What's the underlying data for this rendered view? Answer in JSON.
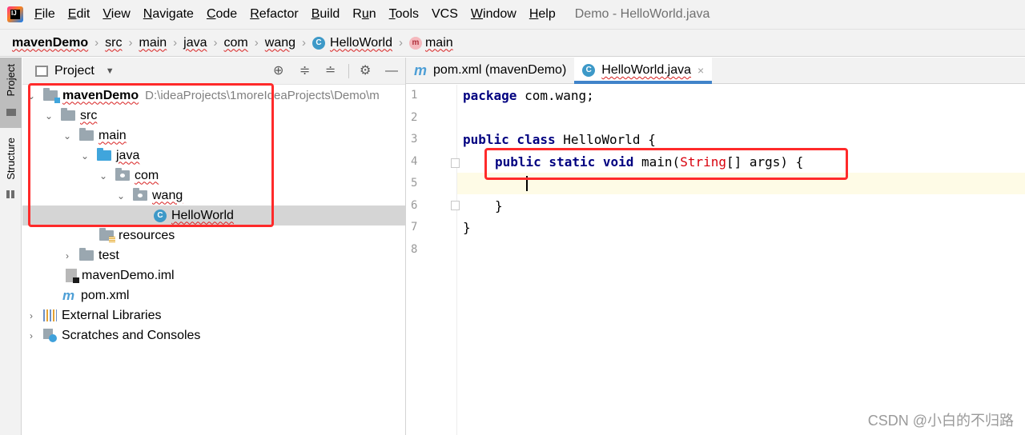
{
  "menubar": {
    "logo_text": "IJ",
    "items": [
      {
        "label": "File",
        "mnemonic": "F",
        "rest": "ile"
      },
      {
        "label": "Edit",
        "mnemonic": "E",
        "rest": "dit"
      },
      {
        "label": "View",
        "mnemonic": "V",
        "rest": "iew"
      },
      {
        "label": "Navigate",
        "mnemonic": "N",
        "rest": "avigate"
      },
      {
        "label": "Code",
        "mnemonic": "C",
        "rest": "ode"
      },
      {
        "label": "Refactor",
        "mnemonic": "R",
        "rest": "efactor"
      },
      {
        "label": "Build",
        "mnemonic": "B",
        "rest": "uild"
      },
      {
        "label": "Run",
        "mnemonic": "u",
        "pre": "R",
        "rest": "n"
      },
      {
        "label": "Tools",
        "mnemonic": "T",
        "rest": "ools"
      },
      {
        "label": "VCS",
        "mnemonic": "",
        "rest": "VCS"
      },
      {
        "label": "Window",
        "mnemonic": "W",
        "rest": "indow"
      },
      {
        "label": "Help",
        "mnemonic": "H",
        "rest": "elp"
      }
    ],
    "window_title": "Demo - HelloWorld.java"
  },
  "breadcrumb": {
    "items": [
      "mavenDemo",
      "src",
      "main",
      "java",
      "com",
      "wang",
      "HelloWorld",
      "main"
    ],
    "class_icon": "C",
    "method_icon": "m"
  },
  "stripe": {
    "project_label": "Project",
    "structure_label": "Structure"
  },
  "project_panel": {
    "title": "Project",
    "tools": [
      "locate-icon",
      "expand-all-icon",
      "collapse-all-icon",
      "gear-icon",
      "minimize-icon"
    ],
    "tree": [
      {
        "name": "mavenDemo",
        "path": "D:\\ideaProjects\\1moreIdeaProjects\\Demo\\m"
      },
      {
        "name": "src"
      },
      {
        "name": "main"
      },
      {
        "name": "java"
      },
      {
        "name": "com"
      },
      {
        "name": "wang"
      },
      {
        "name": "HelloWorld",
        "icon": "C",
        "selected": true
      },
      {
        "name": "resources"
      },
      {
        "name": "test"
      },
      {
        "name": "mavenDemo.iml"
      },
      {
        "name": "pom.xml",
        "icon": "m"
      },
      {
        "name": "External Libraries"
      },
      {
        "name": "Scratches and Consoles"
      }
    ]
  },
  "editor": {
    "tabs": [
      {
        "label": "pom.xml (mavenDemo)",
        "icon": "m",
        "active": false
      },
      {
        "label": "HelloWorld.java",
        "icon": "C",
        "active": true,
        "close": "×"
      }
    ],
    "line_numbers": [
      "1",
      "2",
      "3",
      "4",
      "5",
      "6",
      "7",
      "8"
    ],
    "code": {
      "l1_kw": "package",
      "l1_rest": " com.wang;",
      "l3_kw": "public class",
      "l3_rest": " HelloWorld {",
      "l4_kw": "public static void",
      "l4_mid": " main(",
      "l4_type": "String",
      "l4_rest": "[] args) {",
      "l6": "}",
      "l7": "}"
    },
    "current_line": 5
  },
  "watermark": "CSDN @小白的不归路",
  "colors": {
    "accent_tab": "#4083c9",
    "annotation_red": "#ff2a2a",
    "keyword": "#000080",
    "type_ref": "#d8000c"
  }
}
